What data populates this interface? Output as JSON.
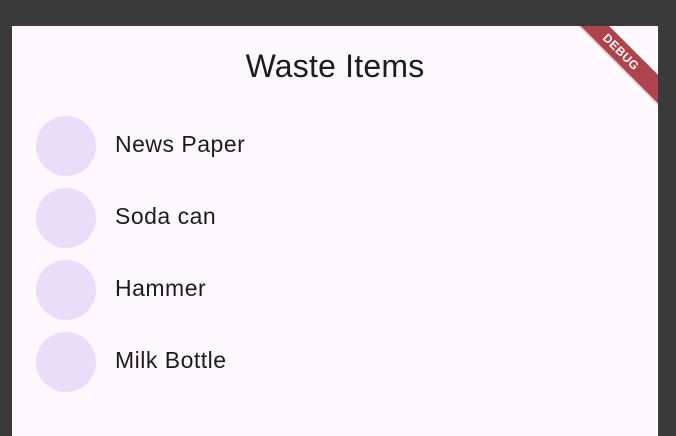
{
  "app": {
    "title": "Waste Items",
    "debug_label": "DEBUG"
  },
  "items": [
    {
      "label": "News Paper"
    },
    {
      "label": "Soda can"
    },
    {
      "label": "Hammer"
    },
    {
      "label": "Milk Bottle"
    }
  ],
  "colors": {
    "background_frame": "#3a3a3a",
    "surface": "#fff8fc",
    "avatar": "#e8defa",
    "text": "#1d1b20",
    "debug_banner": "#b0424b"
  }
}
